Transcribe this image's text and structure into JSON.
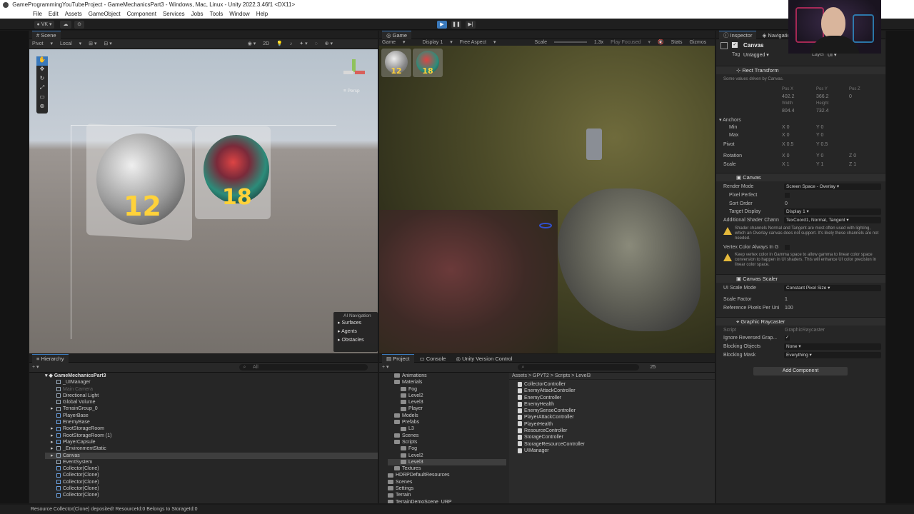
{
  "window_title": "GameProgrammingYouTubeProject - GameMechanicsPart3 - Windows, Mac, Linux - Unity 2022.3.46f1 <DX11>",
  "menu": [
    "File",
    "Edit",
    "Assets",
    "GameObject",
    "Component",
    "Services",
    "Jobs",
    "Tools",
    "Window",
    "Help"
  ],
  "toolbar": {
    "account": "VK"
  },
  "scene": {
    "tab": "Scene",
    "pivot": "Pivot",
    "local": "Local",
    "mode_2d": "2D",
    "persp_label": "≡ Persp",
    "ui_counts": [
      "12",
      "18"
    ],
    "ai_nav": {
      "title": "AI Navigation",
      "items": [
        "Surfaces",
        "Agents",
        "Obstacles"
      ]
    }
  },
  "game": {
    "tab": "Game",
    "mode": "Game",
    "display": "Display 1",
    "aspect": "Free Aspect",
    "scale_label": "Scale",
    "scale_value": "1.3x",
    "play_focused": "Play Focused",
    "stats": "Stats",
    "gizmos": "Gizmos",
    "hud_counts": [
      "12",
      "18"
    ]
  },
  "inspector": {
    "tabs": [
      "Inspector",
      "Navigation"
    ],
    "object_name": "Canvas",
    "tag_label": "Tag",
    "tag_value": "Untagged",
    "layer_label": "Layer",
    "layer_value": "UI",
    "rect_transform": {
      "title": "Rect Transform",
      "note": "Some values driven by Canvas.",
      "pos_x_label": "Pos X",
      "pos_y_label": "Pos Y",
      "pos_z_label": "Pos Z",
      "pos_x": "402.2",
      "pos_y": "366.2",
      "pos_z": "0",
      "width_label": "Width",
      "height_label": "Height",
      "width": "804.4",
      "height": "732.4",
      "anchors": "Anchors",
      "min": "Min",
      "max": "Max",
      "min_x": "X 0",
      "min_y": "Y 0",
      "max_x": "X 0",
      "max_y": "Y 0",
      "pivot": "Pivot",
      "pivot_x": "X 0.5",
      "pivot_y": "Y 0.5",
      "rotation": "Rotation",
      "rot_x": "X 0",
      "rot_y": "Y 0",
      "rot_z": "Z 0",
      "scale": "Scale",
      "scale_x": "X 1",
      "scale_y": "Y 1",
      "scale_z": "Z 1"
    },
    "canvas": {
      "title": "Canvas",
      "render_mode_label": "Render Mode",
      "render_mode": "Screen Space - Overlay",
      "pixel_perfect": "Pixel Perfect",
      "sort_order_label": "Sort Order",
      "sort_order": "0",
      "target_display_label": "Target Display",
      "target_display": "Display 1",
      "shader_channels_label": "Additional Shader Chann",
      "shader_channels": "TexCoord1, Normal, Tangent",
      "warn1": "Shader channels Normal and Tangent are most often used with lighting, which an Overlay canvas does not support. It's likely these channels are not needed.",
      "vertex_color_label": "Vertex Color Always In G",
      "warn2": "Keep vertex color in Gamma space to allow gamma to linear color space conversion to happen in UI shaders. This will enhance UI color precision in linear color space."
    },
    "canvas_scaler": {
      "title": "Canvas Scaler",
      "ui_scale_mode_label": "UI Scale Mode",
      "ui_scale_mode": "Constant Pixel Size",
      "scale_factor_label": "Scale Factor",
      "scale_factor": "1",
      "ref_ppu_label": "Reference Pixels Per Uni",
      "ref_ppu": "100"
    },
    "graphic_raycaster": {
      "title": "Graphic Raycaster",
      "script_label": "Script",
      "script": "GraphicRaycaster",
      "ignore_reversed": "Ignore Reversed Grap...",
      "blocking_objects_label": "Blocking Objects",
      "blocking_objects": "None",
      "blocking_mask_label": "Blocking Mask",
      "blocking_mask": "Everything"
    },
    "add_component": "Add Component"
  },
  "hierarchy": {
    "tab": "Hierarchy",
    "search_placeholder": "All",
    "root": "GameMechanicsPart3",
    "items": [
      "_UIManager",
      "Main Camera",
      "Directional Light",
      "Global Volume",
      "TerrainGroup_0",
      "PlayerBase",
      "EnemyBase",
      "RootStorageRoom",
      "RootStorageRoom (1)",
      "PlayerCapsule",
      "_EnvironmentStatic",
      "Canvas",
      "EventSystem",
      "Collector(Clone)",
      "Collector(Clone)",
      "Collector(Clone)",
      "Collector(Clone)",
      "Collector(Clone)"
    ]
  },
  "project": {
    "tabs": [
      "Project",
      "Console",
      "Unity Version Control"
    ],
    "folders": [
      "Animations",
      "Materials",
      "Fog",
      "Level2",
      "Level3",
      "Player",
      "Models",
      "Prefabs",
      "L3",
      "Scenes",
      "Scripts",
      "Fog",
      "Level2",
      "Level3",
      "Textures",
      "HDRPDefaultResources",
      "Scenes",
      "Settings",
      "Terrain",
      "TerrainDemoScene_URP"
    ],
    "breadcrumb": [
      "Assets",
      "GPYT2",
      "Scripts",
      "Level3"
    ],
    "files": [
      "CollectorController",
      "EnemyAttackController",
      "EnemyController",
      "EnemyHealth",
      "EnemySenseController",
      "PlayerAttackController",
      "PlayerHealth",
      "ResourceController",
      "StorageController",
      "StorageResourceController",
      "UIManager"
    ],
    "badge": "25"
  },
  "status": "Resource Collector(Clone) deposited! ResourceId:0 Belongs to StorageId:0",
  "accent": "#3a79bb"
}
